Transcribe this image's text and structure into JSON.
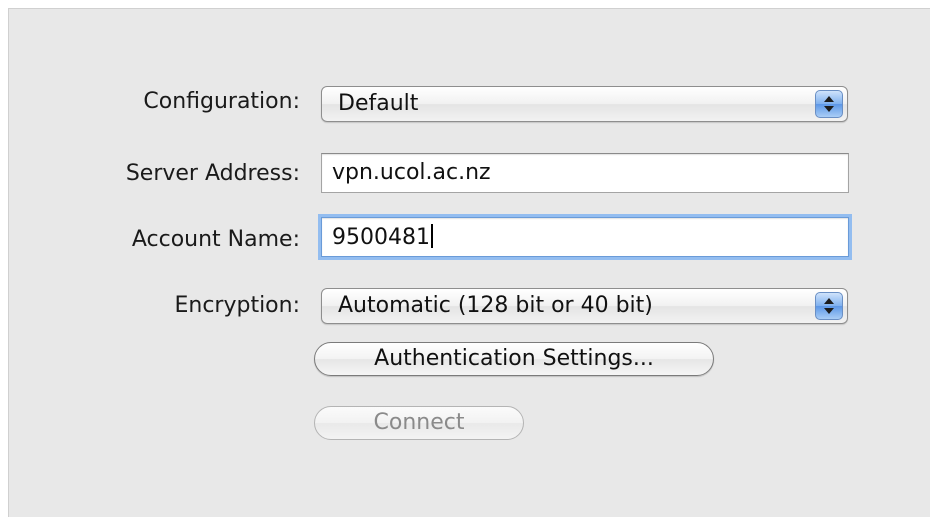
{
  "form": {
    "configuration": {
      "label": "Configuration:",
      "value": "Default"
    },
    "server_address": {
      "label": "Server Address:",
      "value": "vpn.ucol.ac.nz"
    },
    "account_name": {
      "label": "Account Name:",
      "value": "9500481"
    },
    "encryption": {
      "label": "Encryption:",
      "value": "Automatic (128 bit or 40 bit)"
    },
    "auth_button": "Authentication Settings...",
    "connect_button": "Connect"
  },
  "icons": {
    "popup_arrows": "up-down-chevron-icon"
  },
  "colors": {
    "panel_bg": "#e8e8e8",
    "focus_ring": "#93bdf0",
    "popup_accent": "#7fb0ef"
  }
}
